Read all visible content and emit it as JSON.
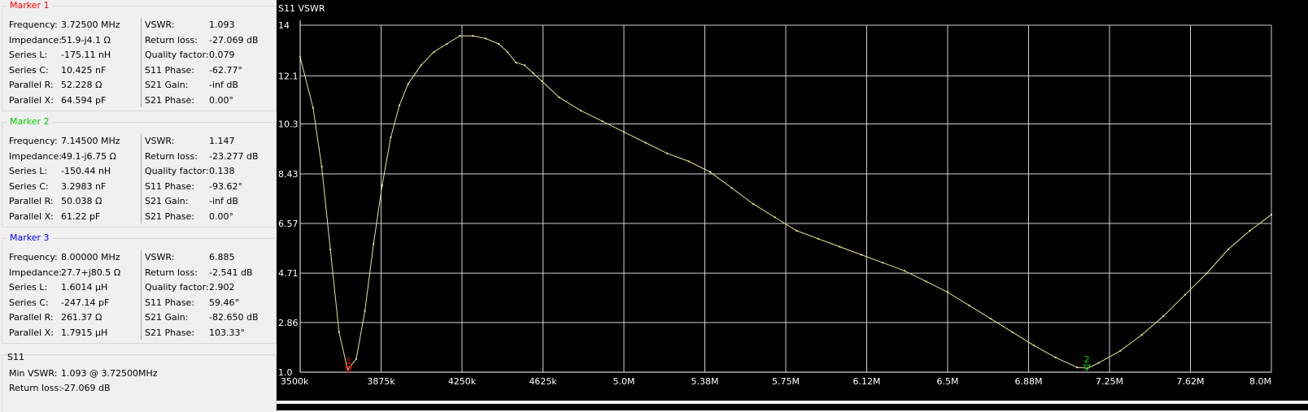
{
  "markers": [
    {
      "title": "Marker 1",
      "color": "#ff0000",
      "left": [
        [
          "Frequency:",
          "3.72500 MHz"
        ],
        [
          "Impedance:",
          "51.9-j4.1 Ω"
        ],
        [
          "Series L:",
          "-175.11 nH"
        ],
        [
          "Series C:",
          "10.425 nF"
        ],
        [
          "Parallel R:",
          "52.228 Ω"
        ],
        [
          "Parallel X:",
          "64.594 pF"
        ]
      ],
      "right": [
        [
          "VSWR:",
          "1.093"
        ],
        [
          "Return loss:",
          "-27.069 dB"
        ],
        [
          "Quality factor:",
          "0.079"
        ],
        [
          "S11 Phase:",
          "-62.77°"
        ],
        [
          "S21 Gain:",
          "-inf dB"
        ],
        [
          "S21 Phase:",
          "0.00°"
        ]
      ]
    },
    {
      "title": "Marker 2",
      "color": "#00d000",
      "left": [
        [
          "Frequency:",
          "7.14500 MHz"
        ],
        [
          "Impedance:",
          "49.1-j6.75 Ω"
        ],
        [
          "Series L:",
          "-150.44 nH"
        ],
        [
          "Series C:",
          "3.2983 nF"
        ],
        [
          "Parallel R:",
          "50.038 Ω"
        ],
        [
          "Parallel X:",
          "61.22 pF"
        ]
      ],
      "right": [
        [
          "VSWR:",
          "1.147"
        ],
        [
          "Return loss:",
          "-23.277 dB"
        ],
        [
          "Quality factor:",
          "0.138"
        ],
        [
          "S11 Phase:",
          "-93.62°"
        ],
        [
          "S21 Gain:",
          "-inf dB"
        ],
        [
          "S21 Phase:",
          "0.00°"
        ]
      ]
    },
    {
      "title": "Marker 3",
      "color": "#0000ff",
      "left": [
        [
          "Frequency:",
          "8.00000 MHz"
        ],
        [
          "Impedance:",
          "27.7+j80.5 Ω"
        ],
        [
          "Series L:",
          "1.6014 µH"
        ],
        [
          "Series C:",
          "-247.14 pF"
        ],
        [
          "Parallel R:",
          "261.37 Ω"
        ],
        [
          "Parallel X:",
          "1.7915 µH"
        ]
      ],
      "right": [
        [
          "VSWR:",
          "6.885"
        ],
        [
          "Return loss:",
          "-2.541 dB"
        ],
        [
          "Quality factor:",
          "2.902"
        ],
        [
          "S11 Phase:",
          "59.46°"
        ],
        [
          "S21 Gain:",
          "-82.650 dB"
        ],
        [
          "S21 Phase:",
          "103.33°"
        ]
      ]
    }
  ],
  "s11": {
    "title": "S11",
    "rows": [
      [
        "Min VSWR:",
        "1.093 @ 3.72500MHz"
      ],
      [
        "Return loss:",
        "-27.069 dB"
      ]
    ]
  },
  "chart_data": {
    "type": "line",
    "title": "S11 VSWR",
    "xlim": [
      3.5,
      8.0
    ],
    "ylim": [
      1.0,
      14.0
    ],
    "x_ticks": [
      3.5,
      3.875,
      4.25,
      4.625,
      5.0,
      5.375,
      5.75,
      6.125,
      6.5,
      6.875,
      7.25,
      7.625,
      8.0
    ],
    "x_tick_labels": [
      "3500k",
      "3875k",
      "4250k",
      "4625k",
      "5.0M",
      "5.38M",
      "5.75M",
      "6.12M",
      "6.5M",
      "6.88M",
      "7.25M",
      "7.62M",
      "8.0M"
    ],
    "y_ticks": [
      1.0,
      2.86,
      4.71,
      6.57,
      8.43,
      10.3,
      12.1,
      14.0
    ],
    "y_tick_labels": [
      "1.0",
      "2.86",
      "4.71",
      "6.57",
      "8.43",
      "10.3",
      "12.1",
      "14"
    ],
    "grid": true,
    "line_color": "#e5e58a",
    "series": [
      {
        "x": [
          3.5,
          3.56,
          3.6,
          3.64,
          3.68,
          3.72,
          3.76,
          3.8,
          3.84,
          3.88,
          3.92,
          3.96,
          4.0,
          4.06,
          4.12,
          4.18,
          4.24,
          4.3,
          4.36,
          4.42,
          4.46,
          4.5,
          4.54,
          4.58,
          4.62,
          4.7,
          4.8,
          4.9,
          5.0,
          5.1,
          5.2,
          5.3,
          5.4,
          5.5,
          5.6,
          5.7,
          5.8,
          5.9,
          6.0,
          6.1,
          6.2,
          6.3,
          6.4,
          6.5,
          6.6,
          6.7,
          6.8,
          6.9,
          7.0,
          7.1,
          7.15,
          7.2,
          7.3,
          7.4,
          7.5,
          7.6,
          7.7,
          7.8,
          7.9,
          8.0
        ],
        "y": [
          12.8,
          10.9,
          8.7,
          5.6,
          2.5,
          1.09,
          1.5,
          3.3,
          5.8,
          8.0,
          9.8,
          11.0,
          11.8,
          12.5,
          13.0,
          13.3,
          13.6,
          13.6,
          13.5,
          13.3,
          13.0,
          12.6,
          12.5,
          12.2,
          11.9,
          11.3,
          10.8,
          10.4,
          10.0,
          9.6,
          9.2,
          8.9,
          8.5,
          7.9,
          7.3,
          6.8,
          6.3,
          6.0,
          5.7,
          5.4,
          5.1,
          4.8,
          4.4,
          4.0,
          3.5,
          3.0,
          2.5,
          2.0,
          1.55,
          1.18,
          1.15,
          1.35,
          1.8,
          2.4,
          3.1,
          3.9,
          4.7,
          5.6,
          6.3,
          6.9
        ]
      }
    ],
    "markers": [
      {
        "label": "1",
        "x": 3.725,
        "y": 1.093,
        "color": "#ff0000"
      },
      {
        "label": "2",
        "x": 7.145,
        "y": 1.147,
        "color": "#00d000"
      }
    ]
  }
}
